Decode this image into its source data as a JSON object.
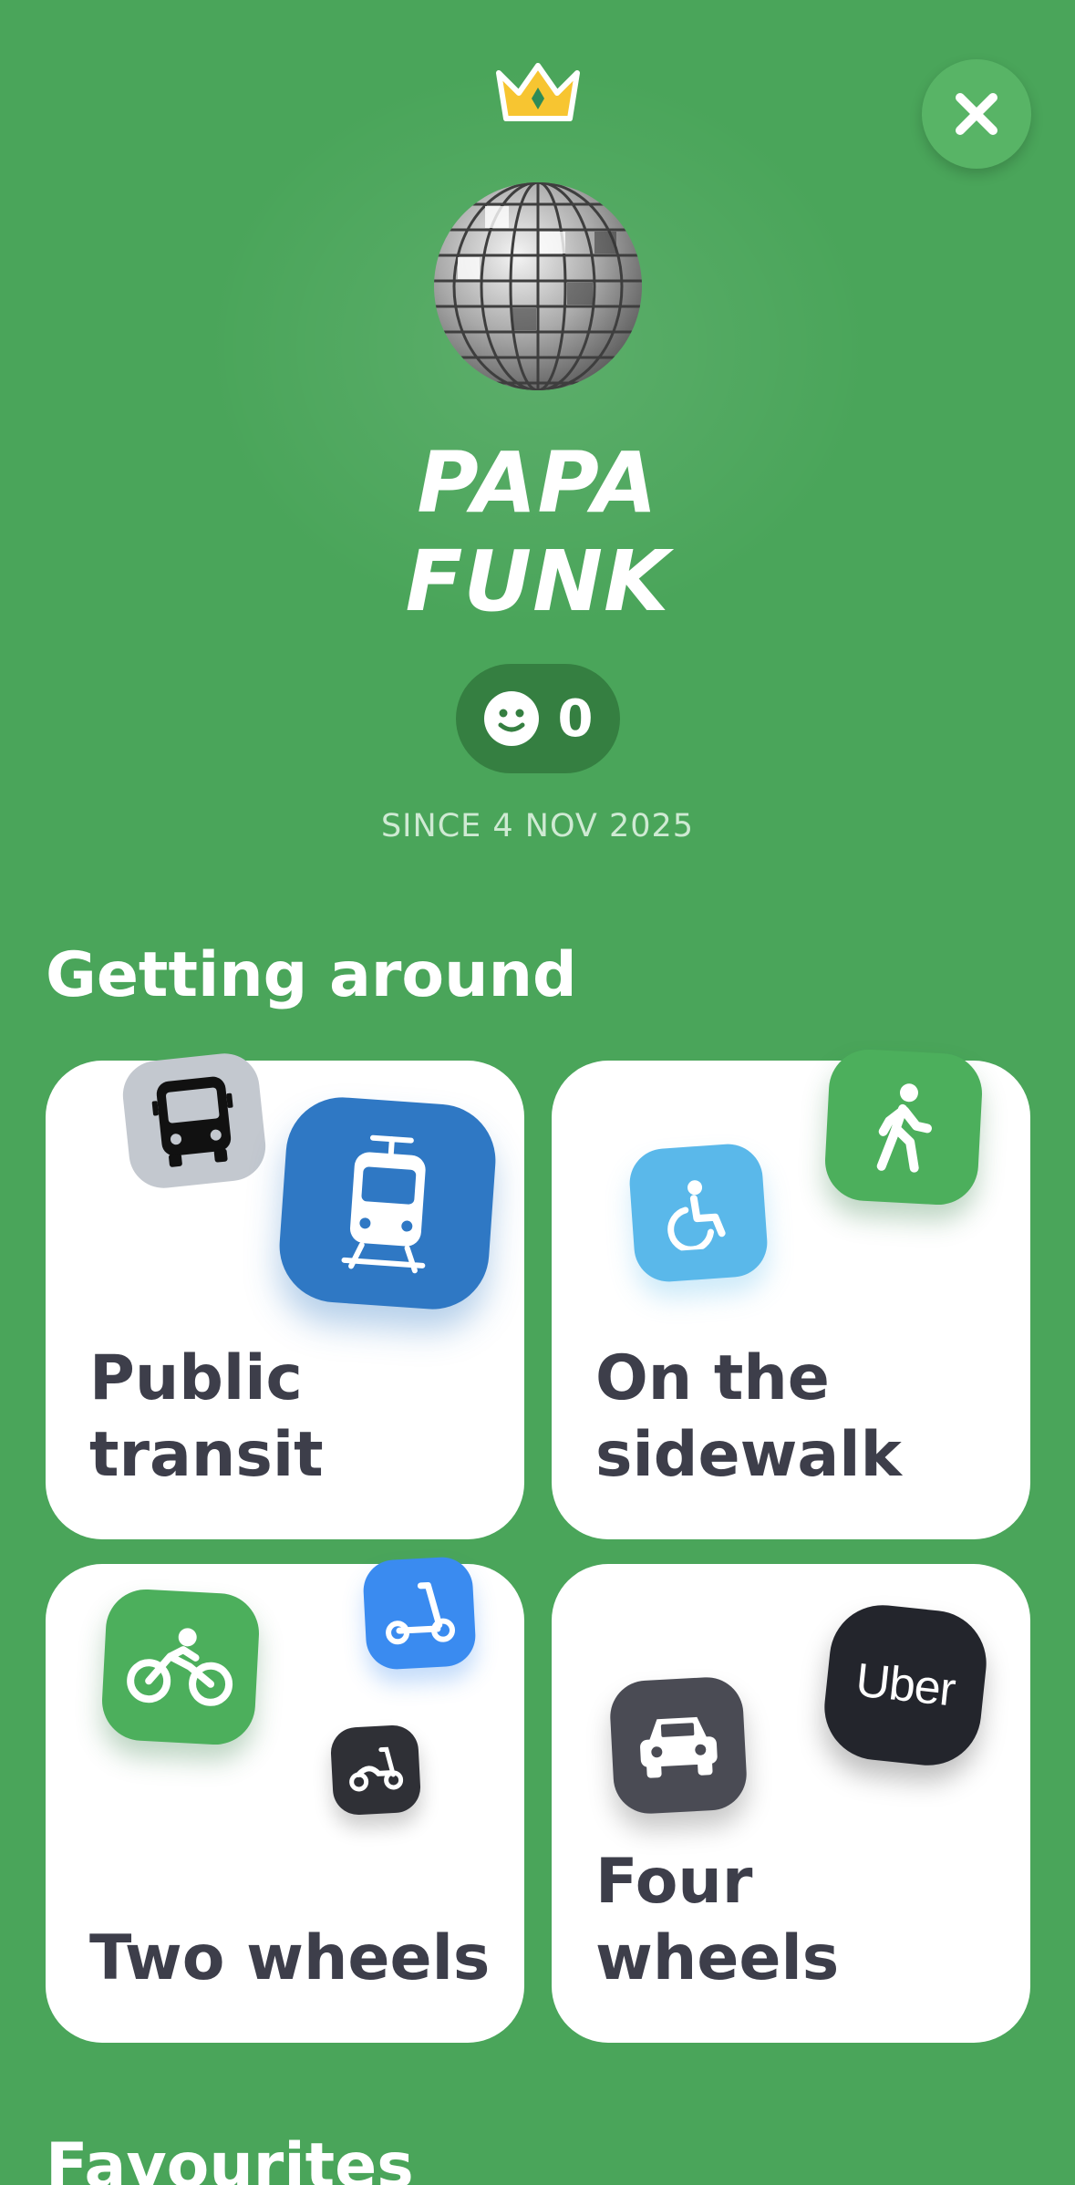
{
  "profile": {
    "name_line1": "PAPA",
    "name_line2": "FUNK",
    "score": "0",
    "since": "SINCE 4 NOV 2025"
  },
  "sections": {
    "getting_around": "Getting around",
    "favourites": "Favourites"
  },
  "cards": [
    {
      "label": "Public transit",
      "icons": [
        "bus-icon",
        "tram-icon"
      ]
    },
    {
      "label": "On the sidewalk",
      "icons": [
        "wheelchair-icon",
        "walking-icon"
      ]
    },
    {
      "label": "Two wheels",
      "icons": [
        "bicycle-icon",
        "scooter-icon",
        "moped-icon"
      ]
    },
    {
      "label": "Four wheels",
      "icons": [
        "car-icon",
        "uber-logo"
      ],
      "brand": "Uber"
    }
  ],
  "icons": {
    "close": "close-icon",
    "crown": "crown-icon",
    "avatar": "disco-ball-avatar",
    "score": "smiley-icon"
  },
  "colors": {
    "background": "#4aa55a",
    "card": "#ffffff",
    "text_dark": "#3d3e4a",
    "tram_blue": "#2f78c4",
    "wheelchair_blue": "#5ab8ea",
    "walk_green": "#4caf5c",
    "scooter_blue": "#3a8bf0",
    "uber_black": "#23252c"
  }
}
